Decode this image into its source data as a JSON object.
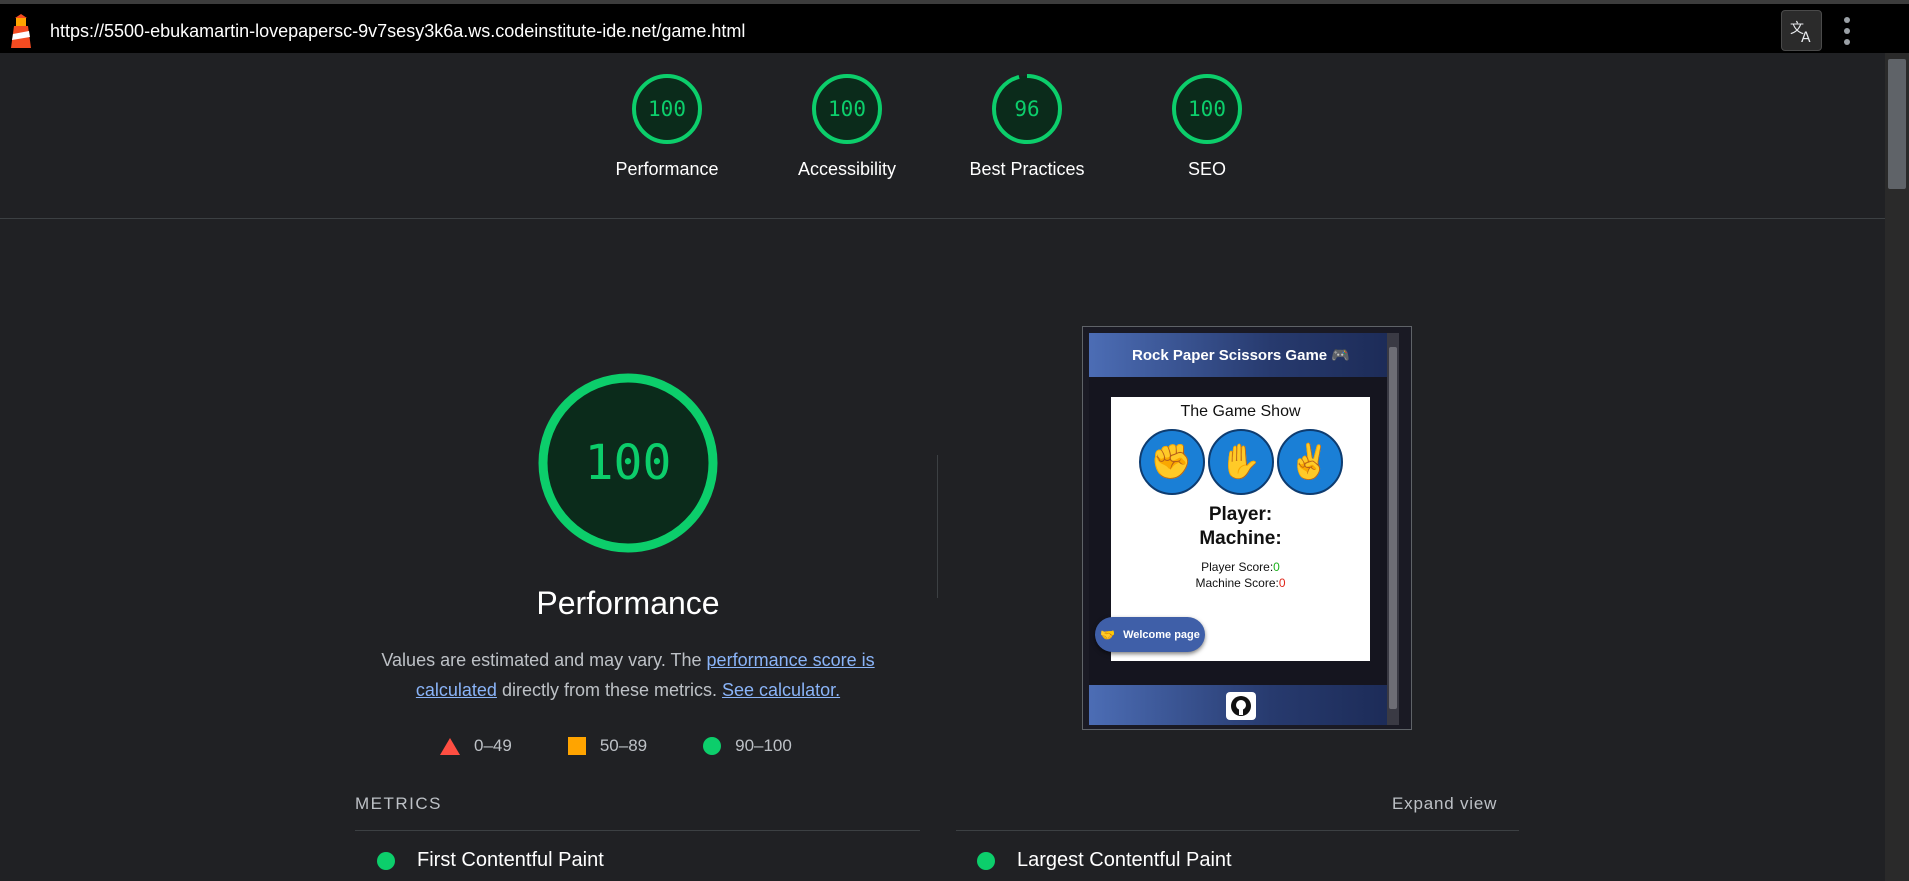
{
  "browser": {
    "url": "https://5500-ebukamartin-lovepapersc-9v7sesy3k6a.ws.codeinstitute-ide.net/game.html"
  },
  "gauges": [
    {
      "score": "100",
      "label": "Performance"
    },
    {
      "score": "100",
      "label": "Accessibility"
    },
    {
      "score": "96",
      "label": "Best Practices"
    },
    {
      "score": "100",
      "label": "SEO"
    }
  ],
  "colors": {
    "pass": "#0cce6b",
    "average": "#ffa400",
    "fail": "#ff4e42"
  },
  "performance": {
    "score": "100",
    "title": "Performance",
    "desc_1": "Values are estimated and may vary. The ",
    "desc_link_1": "performance score is calculated",
    "desc_2": " directly from these metrics. ",
    "desc_link_2": "See calculator."
  },
  "legend": [
    {
      "icon": "fail-triangle-icon",
      "range": "0–49"
    },
    {
      "icon": "average-square-icon",
      "range": "50–89"
    },
    {
      "icon": "pass-circle-icon",
      "range": "90–100"
    }
  ],
  "metrics": {
    "heading": "METRICS",
    "expand_label": "Expand view",
    "items": [
      {
        "label": "First Contentful Paint"
      },
      {
        "label": "Largest Contentful Paint"
      }
    ]
  },
  "screenshot": {
    "header_title": "Rock Paper Scissors Game 🎮",
    "card_title": "The Game Show",
    "player_label": "Player:",
    "machine_label": "Machine:",
    "player_score_label": "Player Score:",
    "player_score": "0",
    "machine_score_label": "Machine Score:",
    "machine_score": "0",
    "welcome_button": "Welcome page",
    "hands": [
      "rock-icon",
      "paper-icon",
      "scissors-icon"
    ]
  }
}
